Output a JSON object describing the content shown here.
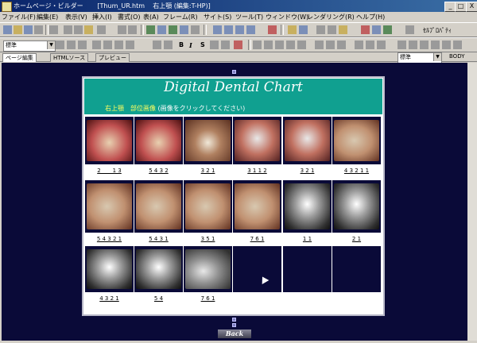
{
  "window": {
    "app_title": "ホームページ・ビルダー",
    "doc_title": "[Thum_UR.htm",
    "doc_subtitle": "右上顎 (編集:T-HP)]",
    "minimize_label": "_",
    "maximize_label": "□",
    "close_label": "X"
  },
  "menubar": {
    "items": [
      "ファイル(F)",
      "編集(E)",
      "表示(V)",
      "挿入(I)",
      "書式(O)",
      "表(A)",
      "フレーム(R)",
      "サイト(S)",
      "ツール(T)",
      "ウィンドウ(W)",
      "レンダリング(R)",
      "ヘルプ(H)"
    ]
  },
  "toolbar": {
    "font_combo": "標準",
    "bold_label": "B",
    "italic_label": "I",
    "strike_label": "S",
    "right_label": "ｾﾙﾌﾟﾛﾊﾟﾃｨ",
    "style_combo": "標準",
    "body_label": "BODY"
  },
  "tabs": [
    "ページ編集",
    "HTMLソース",
    "プレビュー"
  ],
  "chart": {
    "title": "Digital Dental Chart",
    "subtitle_highlight": "右上顎　部位画像",
    "subtitle_rest": "(画像をクリックしてください)"
  },
  "rows": [
    [
      {
        "label": "2 ___ 1 3",
        "kind": "ph1"
      },
      {
        "label": "5 4 3 2",
        "kind": "ph1"
      },
      {
        "label": "3 2 1",
        "kind": "ph2"
      },
      {
        "label": "3 1 1 2",
        "kind": "ph4"
      },
      {
        "label": "3 2 1",
        "kind": "ph4"
      },
      {
        "label": "4 3 2 1 1",
        "kind": "ph3"
      }
    ],
    [
      {
        "label": "5 4 3 2 1",
        "kind": "ph3"
      },
      {
        "label": "5 4 3 1",
        "kind": "ph3"
      },
      {
        "label": "3 5 1",
        "kind": "ph3"
      },
      {
        "label": "7 6 1",
        "kind": "ph3"
      },
      {
        "label": "1 1",
        "kind": "xr"
      },
      {
        "label": "2 1",
        "kind": "xr"
      }
    ],
    [
      {
        "label": "4 3 2 1",
        "kind": "xr"
      },
      {
        "label": "5 4",
        "kind": "xr"
      },
      {
        "label": "7 6 1",
        "kind": "xrh"
      },
      {
        "label": "",
        "kind": "empty"
      },
      {
        "label": "",
        "kind": "empty"
      },
      {
        "label": "",
        "kind": "empty"
      }
    ]
  ],
  "back_button": "Back"
}
